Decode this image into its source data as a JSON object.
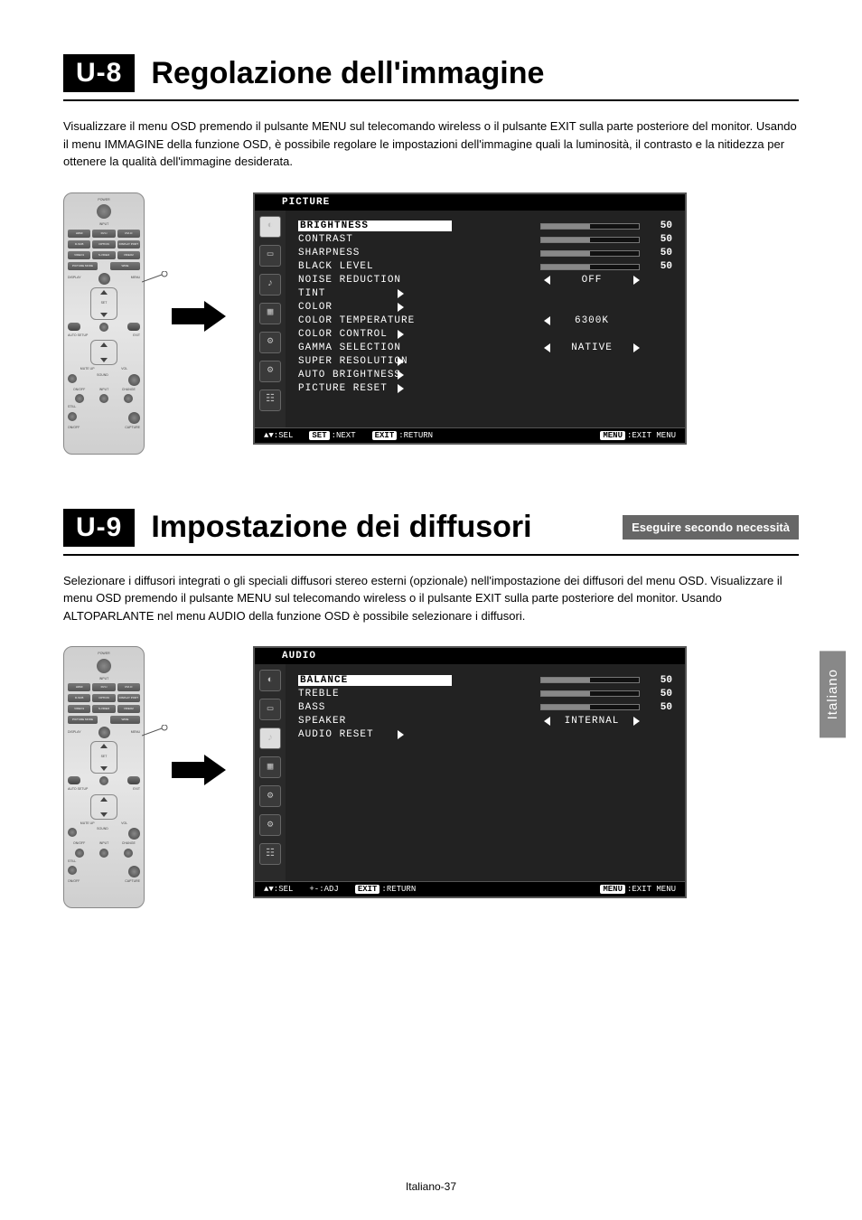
{
  "sections": [
    {
      "badge": "U-8",
      "title": "Regolazione dell'immagine",
      "note": null,
      "body": "Visualizzare il menu OSD premendo il pulsante MENU sul telecomando wireless o il pulsante EXIT sulla parte posteriore del monitor. Usando il menu IMMAGINE della funzione OSD, è possibile regolare le impostazioni dell'immagine quali la luminosità, il contrasto e la nitidezza per ottenere la qualità dell'immagine desiderata.",
      "osd": {
        "title": "PICTURE",
        "rows": [
          {
            "name": "BRIGHTNESS",
            "type": "slider",
            "value": 50,
            "highlight": true
          },
          {
            "name": "CONTRAST",
            "type": "slider",
            "value": 50
          },
          {
            "name": "SHARPNESS",
            "type": "slider",
            "value": 50
          },
          {
            "name": "BLACK LEVEL",
            "type": "slider",
            "value": 50
          },
          {
            "name": "NOISE REDUCTION",
            "type": "choice",
            "value": "OFF",
            "left": true,
            "right": true
          },
          {
            "name": "TINT",
            "type": "submenu"
          },
          {
            "name": "COLOR",
            "type": "submenu"
          },
          {
            "name": "COLOR TEMPERATURE",
            "type": "choice",
            "value": "6300K",
            "left": true
          },
          {
            "name": "COLOR CONTROL",
            "type": "submenu"
          },
          {
            "name": "GAMMA SELECTION",
            "type": "choice",
            "value": "NATIVE",
            "left": true,
            "right": true
          },
          {
            "name": "SUPER RESOLUTION",
            "type": "submenu"
          },
          {
            "name": "AUTO BRIGHTNESS",
            "type": "submenu"
          },
          {
            "name": "PICTURE RESET",
            "type": "submenu"
          }
        ],
        "hints": {
          "sel": "SEL",
          "set": "SET",
          "set_txt": "NEXT",
          "exit": "EXIT",
          "exit_txt": "RETURN",
          "menu": "MENU",
          "menu_txt": "EXIT MENU"
        }
      }
    },
    {
      "badge": "U-9",
      "title": "Impostazione dei diffusori",
      "note": "Eseguire secondo necessità",
      "body": "Selezionare i diffusori integrati o gli speciali diffusori stereo esterni (opzionale) nell'impostazione dei diffusori del menu OSD. Visualizzare il menu OSD premendo il pulsante MENU sul telecomando wireless o il pulsante EXIT sulla parte posteriore del monitor. Usando ALTOPARLANTE nel menu AUDIO della funzione OSD è possibile selezionare i diffusori.",
      "osd": {
        "title": "AUDIO",
        "rows": [
          {
            "name": "BALANCE",
            "type": "slider",
            "value": 50,
            "highlight": true
          },
          {
            "name": "TREBLE",
            "type": "slider",
            "value": 50
          },
          {
            "name": "BASS",
            "type": "slider",
            "value": 50
          },
          {
            "name": "SPEAKER",
            "type": "choice",
            "value": "INTERNAL",
            "left": true,
            "right": true
          },
          {
            "name": "AUDIO RESET",
            "type": "submenu"
          }
        ],
        "hints": {
          "sel": "SEL",
          "adj": "+-",
          "adj_txt": "ADJ",
          "exit": "EXIT",
          "exit_txt": "RETURN",
          "menu": "MENU",
          "menu_txt": "EXIT MENU"
        }
      }
    }
  ],
  "remote_labels": {
    "power": "POWER",
    "input": "INPUT",
    "row1": [
      "HDMI",
      "DVI-I",
      "DVI-D"
    ],
    "row2": [
      "D-SUB",
      "OPTION",
      "DISPLAY PORT"
    ],
    "row3": [
      "VIDEO1",
      "S-VIDEO",
      "VIDEO2"
    ],
    "pic_mode": "PICTURE MODE",
    "wide": "WIDE",
    "display": "DISPLAY",
    "menu": "MENU",
    "set": "SET",
    "auto_setup": "AUTO SETUP",
    "exit": "EXIT",
    "mute_up": "MUTE UP",
    "vol": "VOL",
    "sound": "SOUND",
    "pip_row": [
      "ON/OFF",
      "INPUT",
      "CHANGE"
    ],
    "still": "STILL",
    "capture": "CAPTURE"
  },
  "side_tab": "Italiano",
  "footer": "Italiano-37"
}
